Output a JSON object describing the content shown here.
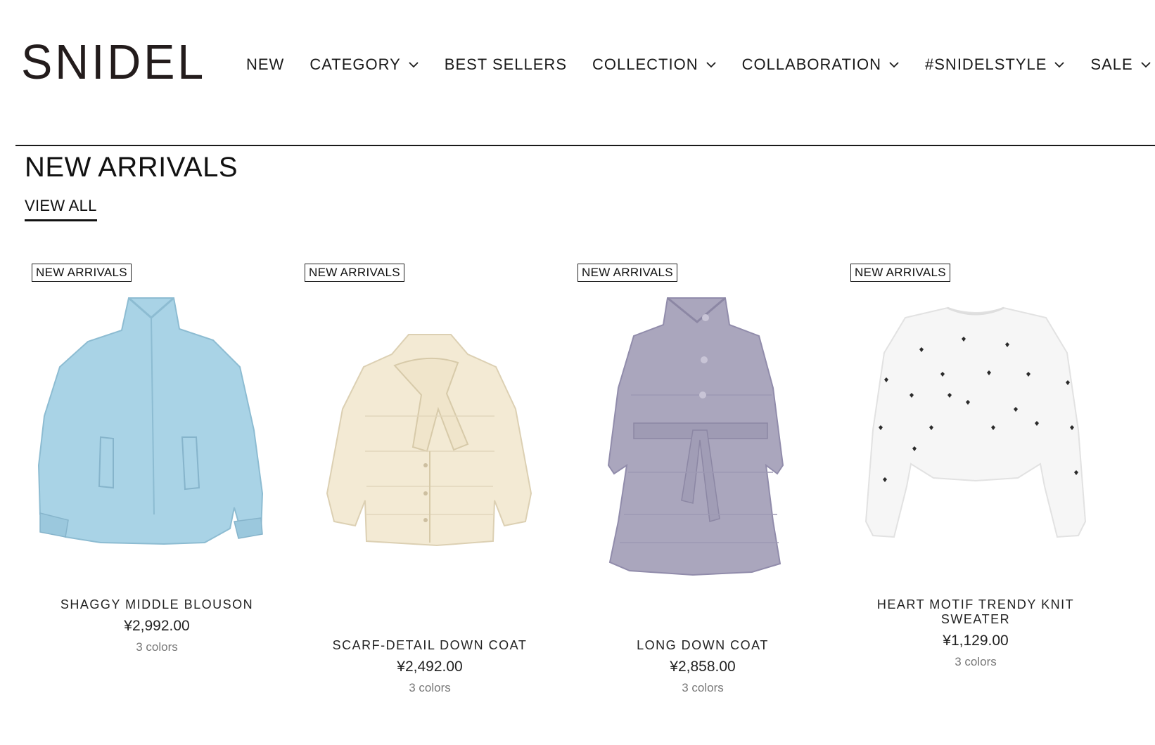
{
  "brand": {
    "logo_text": "SNIDEL"
  },
  "nav": {
    "items": [
      {
        "label": "NEW",
        "has_dropdown": false
      },
      {
        "label": "CATEGORY",
        "has_dropdown": true
      },
      {
        "label": "BEST SELLERS",
        "has_dropdown": false
      },
      {
        "label": "COLLECTION",
        "has_dropdown": true
      },
      {
        "label": "COLLABORATION",
        "has_dropdown": true
      },
      {
        "label": "#SNIDELSTYLE",
        "has_dropdown": true
      },
      {
        "label": "SALE",
        "has_dropdown": true
      }
    ]
  },
  "section": {
    "title": "NEW ARRIVALS",
    "view_all": "VIEW ALL"
  },
  "products": [
    {
      "badge": "NEW ARRIVALS",
      "name": "SHAGGY MIDDLE BLOUSON",
      "price": "¥2,992.00",
      "colors": "3 colors",
      "image_icon": "light-blue-blouson-photo"
    },
    {
      "badge": "NEW ARRIVALS",
      "name": "SCARF-DETAIL DOWN COAT",
      "price": "¥2,492.00",
      "colors": "3 colors",
      "image_icon": "cream-down-coat-photo"
    },
    {
      "badge": "NEW ARRIVALS",
      "name": "LONG DOWN COAT",
      "price": "¥2,858.00",
      "colors": "3 colors",
      "image_icon": "lavender-long-down-coat-photo"
    },
    {
      "badge": "NEW ARRIVALS",
      "name": "HEART MOTIF TRENDY KNIT SWEATER",
      "price": "¥1,129.00",
      "colors": "3 colors",
      "image_icon": "white-heart-knit-sweater-photo"
    }
  ],
  "colors": {
    "text": "#1a1a1a",
    "muted": "#777777",
    "blouson": "#a9d3e6",
    "down_coat": "#f3ead4",
    "long_coat": "#aaa6bd",
    "sweater": "#f6f6f6"
  }
}
